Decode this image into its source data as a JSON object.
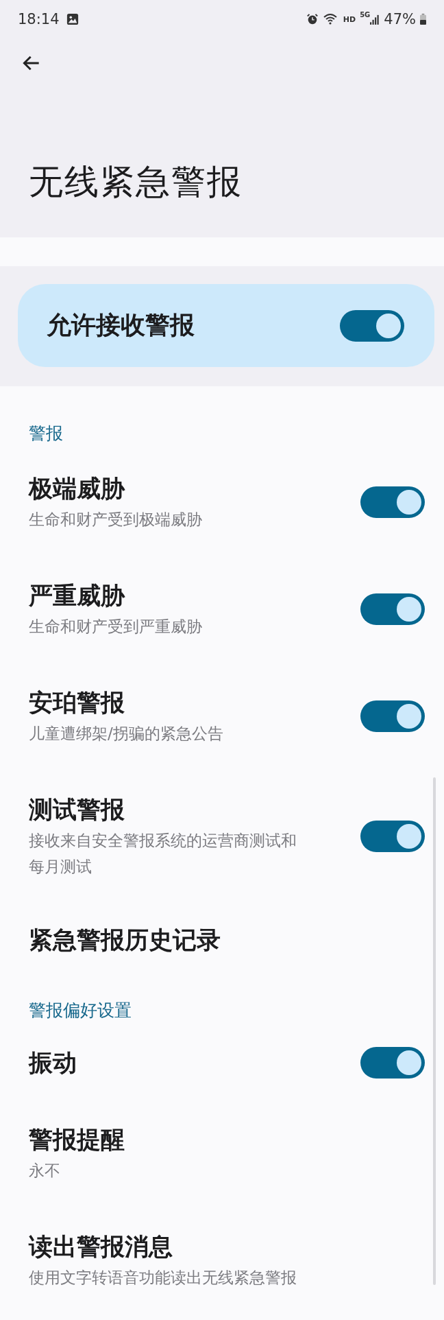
{
  "status_bar": {
    "time": "18:14",
    "network": "HD",
    "cell": "5G",
    "battery": "47%"
  },
  "header": {
    "title": "无线紧急警报"
  },
  "master": {
    "label": "允许接收警报",
    "on": true
  },
  "sections": [
    {
      "title": "警报",
      "items": [
        {
          "kind": "toggle",
          "title": "极端威胁",
          "subtitle": "生命和财产受到极端威胁",
          "on": true
        },
        {
          "kind": "toggle",
          "title": "严重威胁",
          "subtitle": "生命和财产受到严重威胁",
          "on": true
        },
        {
          "kind": "toggle",
          "title": "安珀警报",
          "subtitle": "儿童遭绑架/拐骗的紧急公告",
          "on": true
        },
        {
          "kind": "toggle",
          "title": "测试警报",
          "subtitle": "接收来自安全警报系统的运营商测试和每月测试",
          "on": true
        },
        {
          "kind": "plain",
          "title": "紧急警报历史记录"
        }
      ]
    },
    {
      "title": "警报偏好设置",
      "items": [
        {
          "kind": "toggle",
          "title": "振动",
          "on": true
        },
        {
          "kind": "plain",
          "title": "警报提醒",
          "subtitle": "永不"
        },
        {
          "kind": "plain",
          "title": "读出警报消息",
          "subtitle": "使用文字转语音功能读出无线紧急警报"
        }
      ]
    }
  ]
}
